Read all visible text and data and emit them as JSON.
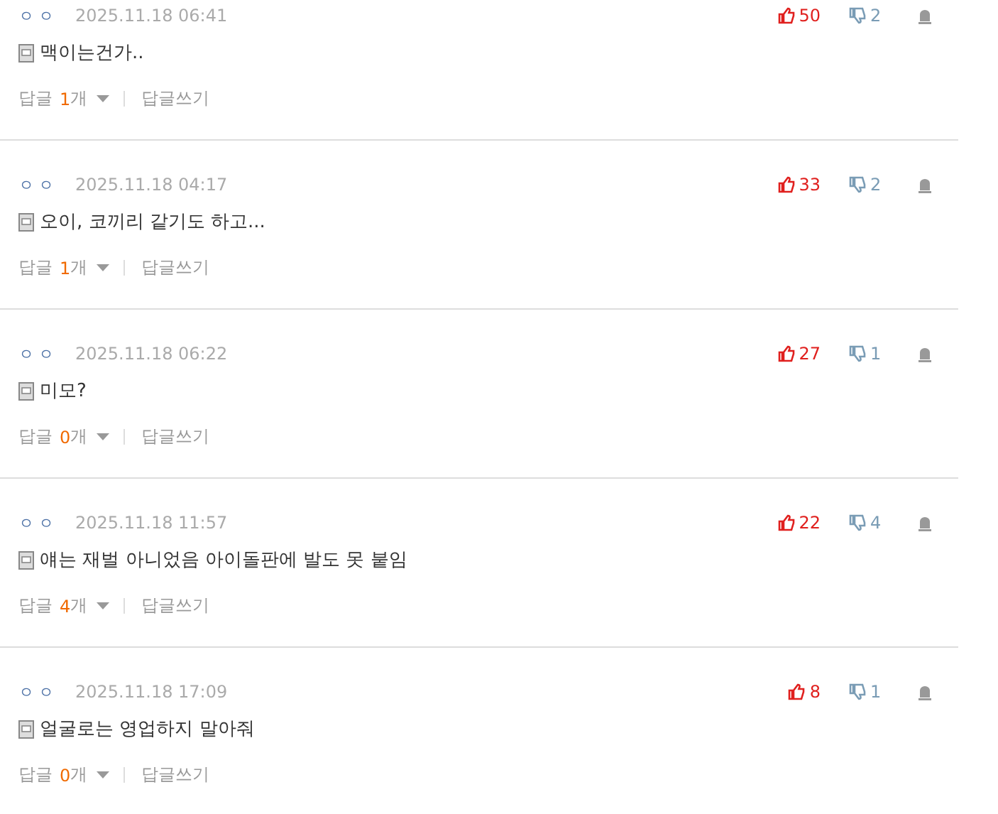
{
  "comments": [
    {
      "author": "ㅇㅇ",
      "date": "2025.11.18 06:41",
      "likes": "50",
      "dislikes": "2",
      "text": "맥이는건가..",
      "reply_label": "답글",
      "reply_count": "1",
      "reply_unit": "개",
      "write_reply": "답글쓰기"
    },
    {
      "author": "ㅇㅇ",
      "date": "2025.11.18 04:17",
      "likes": "33",
      "dislikes": "2",
      "text": "오이, 코끼리 같기도 하고...",
      "reply_label": "답글",
      "reply_count": "1",
      "reply_unit": "개",
      "write_reply": "답글쓰기"
    },
    {
      "author": "ㅇㅇ",
      "date": "2025.11.18 06:22",
      "likes": "27",
      "dislikes": "1",
      "text": "미모?",
      "reply_label": "답글",
      "reply_count": "0",
      "reply_unit": "개",
      "write_reply": "답글쓰기"
    },
    {
      "author": "ㅇㅇ",
      "date": "2025.11.18 11:57",
      "likes": "22",
      "dislikes": "4",
      "text": "얘는 재벌 아니었음 아이돌판에 발도 못 붙임",
      "reply_label": "답글",
      "reply_count": "4",
      "reply_unit": "개",
      "write_reply": "답글쓰기"
    },
    {
      "author": "ㅇㅇ",
      "date": "2025.11.18 17:09",
      "likes": "8",
      "dislikes": "1",
      "text": "얼굴로는 영업하지 말아줘",
      "reply_label": "답글",
      "reply_count": "0",
      "reply_unit": "개",
      "write_reply": "답글쓰기"
    }
  ]
}
